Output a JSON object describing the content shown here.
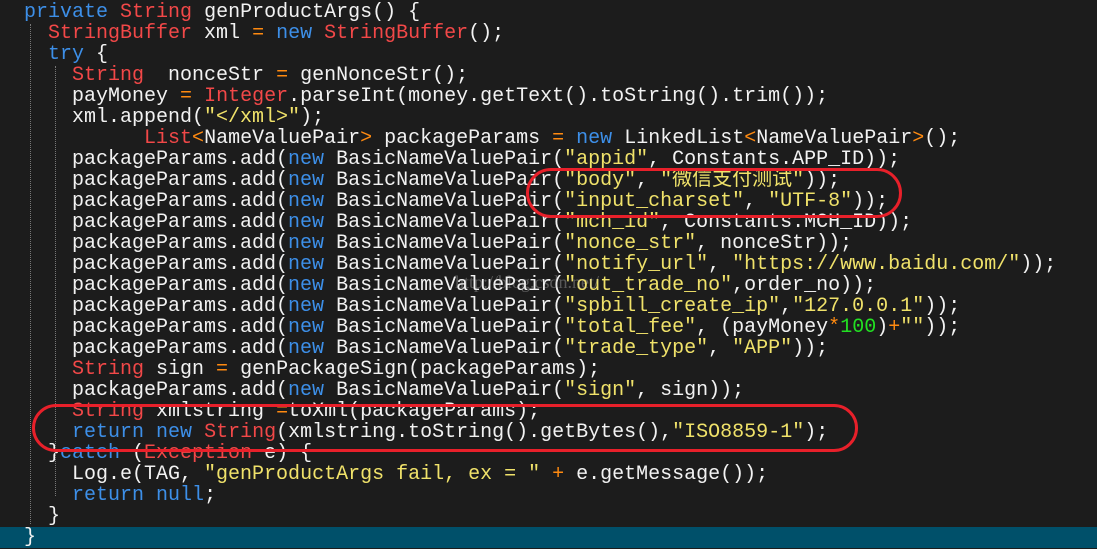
{
  "colors": {
    "background": "#1c1c1c",
    "keyword": "#3d8fe8",
    "type": "#f24848",
    "string": "#f0e26a",
    "operator": "#ff8a10",
    "number": "#22e022",
    "current_line": "#00506a",
    "annotation": "#e8202a"
  },
  "watermark": "http://blog.csdn.net/",
  "lines": [
    [
      [
        "plain",
        "  "
      ],
      [
        "kw",
        "private"
      ],
      [
        "plain",
        " "
      ],
      [
        "type",
        "String"
      ],
      [
        "plain",
        " genProductArgs() {"
      ]
    ],
    [
      [
        "plain",
        "    "
      ],
      [
        "type",
        "StringBuffer"
      ],
      [
        "plain",
        " xml "
      ],
      [
        "op",
        "="
      ],
      [
        "plain",
        " "
      ],
      [
        "kw",
        "new"
      ],
      [
        "plain",
        " "
      ],
      [
        "type",
        "StringBuffer"
      ],
      [
        "plain",
        "();"
      ]
    ],
    [
      [
        "plain",
        "    "
      ],
      [
        "kw",
        "try"
      ],
      [
        "plain",
        " {"
      ]
    ],
    [
      [
        "plain",
        "      "
      ],
      [
        "type",
        "String"
      ],
      [
        "plain",
        "  nonceStr "
      ],
      [
        "op",
        "="
      ],
      [
        "plain",
        " genNonceStr();"
      ]
    ],
    [
      [
        "plain",
        "      payMoney "
      ],
      [
        "op",
        "="
      ],
      [
        "plain",
        " "
      ],
      [
        "type",
        "Integer"
      ],
      [
        "plain",
        ".parseInt(money.getText().toString().trim());"
      ]
    ],
    [
      [
        "plain",
        "      xml.append("
      ],
      [
        "str",
        "\"</xml>\""
      ],
      [
        "plain",
        ");"
      ]
    ],
    [
      [
        "plain",
        "            "
      ],
      [
        "type",
        "List"
      ],
      [
        "op",
        "<"
      ],
      [
        "plain",
        "NameValuePair"
      ],
      [
        "op",
        ">"
      ],
      [
        "plain",
        " packageParams "
      ],
      [
        "op",
        "="
      ],
      [
        "plain",
        " "
      ],
      [
        "kw",
        "new"
      ],
      [
        "plain",
        " LinkedList"
      ],
      [
        "op",
        "<"
      ],
      [
        "plain",
        "NameValuePair"
      ],
      [
        "op",
        ">"
      ],
      [
        "plain",
        "();"
      ]
    ],
    [
      [
        "plain",
        "      packageParams.add("
      ],
      [
        "kw",
        "new"
      ],
      [
        "plain",
        " BasicNameValuePair("
      ],
      [
        "str",
        "\"appid\""
      ],
      [
        "plain",
        ", Constants.APP_ID));"
      ]
    ],
    [
      [
        "plain",
        "      packageParams.add("
      ],
      [
        "kw",
        "new"
      ],
      [
        "plain",
        " BasicNameValuePair("
      ],
      [
        "str",
        "\"body\""
      ],
      [
        "plain",
        ", "
      ],
      [
        "str",
        "\"微信支付测试\""
      ],
      [
        "plain",
        "));"
      ]
    ],
    [
      [
        "plain",
        "      packageParams.add("
      ],
      [
        "kw",
        "new"
      ],
      [
        "plain",
        " BasicNameValuePair("
      ],
      [
        "str",
        "\"input_charset\""
      ],
      [
        "plain",
        ", "
      ],
      [
        "str",
        "\"UTF-8\""
      ],
      [
        "plain",
        "));"
      ]
    ],
    [
      [
        "plain",
        "      packageParams.add("
      ],
      [
        "kw",
        "new"
      ],
      [
        "plain",
        " BasicNameValuePair("
      ],
      [
        "str",
        "\"mch_id\""
      ],
      [
        "plain",
        ", Constants.MCH_ID));"
      ]
    ],
    [
      [
        "plain",
        "      packageParams.add("
      ],
      [
        "kw",
        "new"
      ],
      [
        "plain",
        " BasicNameValuePair("
      ],
      [
        "str",
        "\"nonce_str\""
      ],
      [
        "plain",
        ", nonceStr));"
      ]
    ],
    [
      [
        "plain",
        "      packageParams.add("
      ],
      [
        "kw",
        "new"
      ],
      [
        "plain",
        " BasicNameValuePair("
      ],
      [
        "str",
        "\"notify_url\""
      ],
      [
        "plain",
        ", "
      ],
      [
        "str",
        "\"https://www.baidu.com/\""
      ],
      [
        "plain",
        "));"
      ]
    ],
    [
      [
        "plain",
        "      packageParams.add("
      ],
      [
        "kw",
        "new"
      ],
      [
        "plain",
        " BasicNameValuePair("
      ],
      [
        "str",
        "\"out_trade_no\""
      ],
      [
        "plain",
        ",order_no));"
      ]
    ],
    [
      [
        "plain",
        "      packageParams.add("
      ],
      [
        "kw",
        "new"
      ],
      [
        "plain",
        " BasicNameValuePair("
      ],
      [
        "str",
        "\"spbill_create_ip\""
      ],
      [
        "plain",
        ","
      ],
      [
        "str",
        "\"127.0.0.1\""
      ],
      [
        "plain",
        "));"
      ]
    ],
    [
      [
        "plain",
        "      packageParams.add("
      ],
      [
        "kw",
        "new"
      ],
      [
        "plain",
        " BasicNameValuePair("
      ],
      [
        "str",
        "\"total_fee\""
      ],
      [
        "plain",
        ", (payMoney"
      ],
      [
        "op",
        "*"
      ],
      [
        "num",
        "100"
      ],
      [
        "plain",
        ")"
      ],
      [
        "op",
        "+"
      ],
      [
        "str",
        "\"\""
      ],
      [
        "plain",
        "));"
      ]
    ],
    [
      [
        "plain",
        "      packageParams.add("
      ],
      [
        "kw",
        "new"
      ],
      [
        "plain",
        " BasicNameValuePair("
      ],
      [
        "str",
        "\"trade_type\""
      ],
      [
        "plain",
        ", "
      ],
      [
        "str",
        "\"APP\""
      ],
      [
        "plain",
        "));"
      ]
    ],
    [
      [
        "plain",
        "      "
      ],
      [
        "type",
        "String"
      ],
      [
        "plain",
        " sign "
      ],
      [
        "op",
        "="
      ],
      [
        "plain",
        " genPackageSign(packageParams);"
      ]
    ],
    [
      [
        "plain",
        "      packageParams.add("
      ],
      [
        "kw",
        "new"
      ],
      [
        "plain",
        " BasicNameValuePair("
      ],
      [
        "str",
        "\"sign\""
      ],
      [
        "plain",
        ", sign));"
      ]
    ],
    [
      [
        "plain",
        "      "
      ],
      [
        "type",
        "String"
      ],
      [
        "plain",
        " xmlstring "
      ],
      [
        "op",
        "="
      ],
      [
        "plain",
        "toXml(packageParams);"
      ]
    ],
    [
      [
        "plain",
        "      "
      ],
      [
        "kw",
        "return"
      ],
      [
        "plain",
        " "
      ],
      [
        "kw",
        "new"
      ],
      [
        "plain",
        " "
      ],
      [
        "type",
        "String"
      ],
      [
        "plain",
        "(xmlstring.toString().getBytes(),"
      ],
      [
        "str",
        "\"ISO8859-1\""
      ],
      [
        "plain",
        ");"
      ]
    ],
    [
      [
        "plain",
        "    }"
      ],
      [
        "kw",
        "catch"
      ],
      [
        "plain",
        " ("
      ],
      [
        "type",
        "Exception"
      ],
      [
        "plain",
        " e) {"
      ]
    ],
    [
      [
        "plain",
        "      Log.e(TAG, "
      ],
      [
        "str",
        "\"genProductArgs fail, ex = \""
      ],
      [
        "plain",
        " "
      ],
      [
        "op",
        "+"
      ],
      [
        "plain",
        " e.getMessage());"
      ]
    ],
    [
      [
        "plain",
        "      "
      ],
      [
        "kw",
        "return"
      ],
      [
        "plain",
        " "
      ],
      [
        "kw",
        "null"
      ],
      [
        "plain",
        ";"
      ]
    ],
    [
      [
        "plain",
        "    }"
      ]
    ],
    [
      [
        "plain",
        "  }"
      ]
    ]
  ]
}
